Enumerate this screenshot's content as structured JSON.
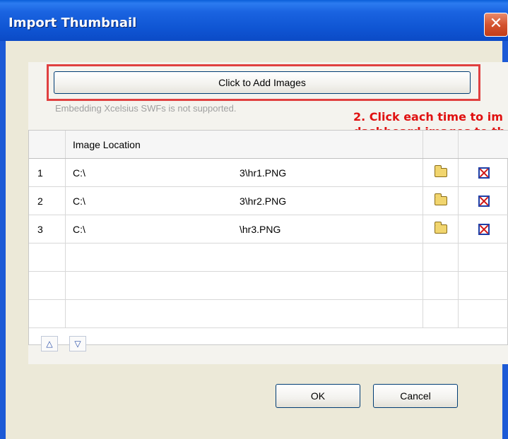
{
  "window": {
    "title": "Import Thumbnail",
    "close_glyph": "✕"
  },
  "add_images": {
    "button_label": "Click to Add Images",
    "note": "Embedding Xcelsius SWFs is not supported."
  },
  "annotation": {
    "line1": "2. Click each time to im",
    "line2": "dashboard images to th"
  },
  "table": {
    "headers": [
      "",
      "Image Location",
      "",
      ""
    ],
    "rows": [
      {
        "index": "1",
        "path_prefix": "C:\\",
        "path_file": "3\\hr1.PNG",
        "open_icon": "folder-icon",
        "delete_icon": "delete-icon"
      },
      {
        "index": "2",
        "path_prefix": "C:\\",
        "path_file": "3\\hr2.PNG",
        "open_icon": "folder-icon",
        "delete_icon": "delete-icon"
      },
      {
        "index": "3",
        "path_prefix": "C:\\",
        "path_file": "\\hr3.PNG",
        "open_icon": "folder-icon",
        "delete_icon": "delete-icon"
      }
    ]
  },
  "move_buttons": {
    "up_glyph": "△",
    "down_glyph": "▽"
  },
  "buttons": {
    "ok": "OK",
    "cancel": "Cancel"
  },
  "colors": {
    "titlebar": "#0b4ac6",
    "annotation": "#e01010",
    "highlight_box": "#e04040"
  }
}
